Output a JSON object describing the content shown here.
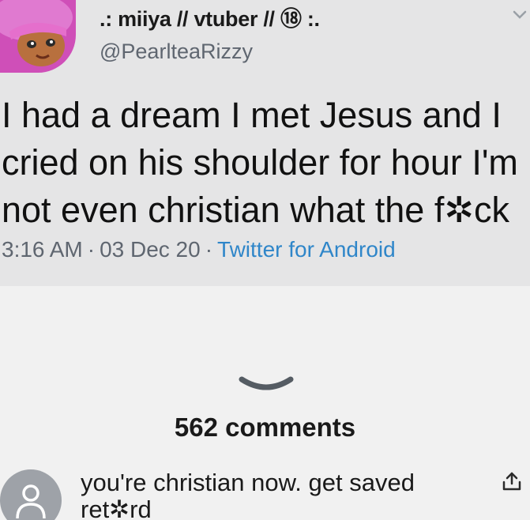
{
  "tweet": {
    "display_name": ".: miiya // vtuber // ⑱ :.",
    "handle": "@PearlteaRizzy",
    "text": "I had a dream I met Jesus and I\ncried on his shoulder for hour I'm\nnot even christian what the f✲ck",
    "time": "3:16 AM",
    "date": "03 Dec 20",
    "source": "Twitter for Android",
    "separator": "·"
  },
  "comments": {
    "count_label": "562 comments",
    "first_comment_text": "you're christian now. get saved ret✲rd"
  },
  "icons": {
    "avatar": "avatar-icon",
    "caret": "chevron-down-icon",
    "expand": "chevron-down-icon",
    "commenter_avatar": "user-icon",
    "share": "share-icon"
  },
  "colors": {
    "tweet_background": "#e5e5e6",
    "page_background": "#f1f1f1",
    "link": "#2f86c9",
    "secondary_text": "#5f6670"
  }
}
